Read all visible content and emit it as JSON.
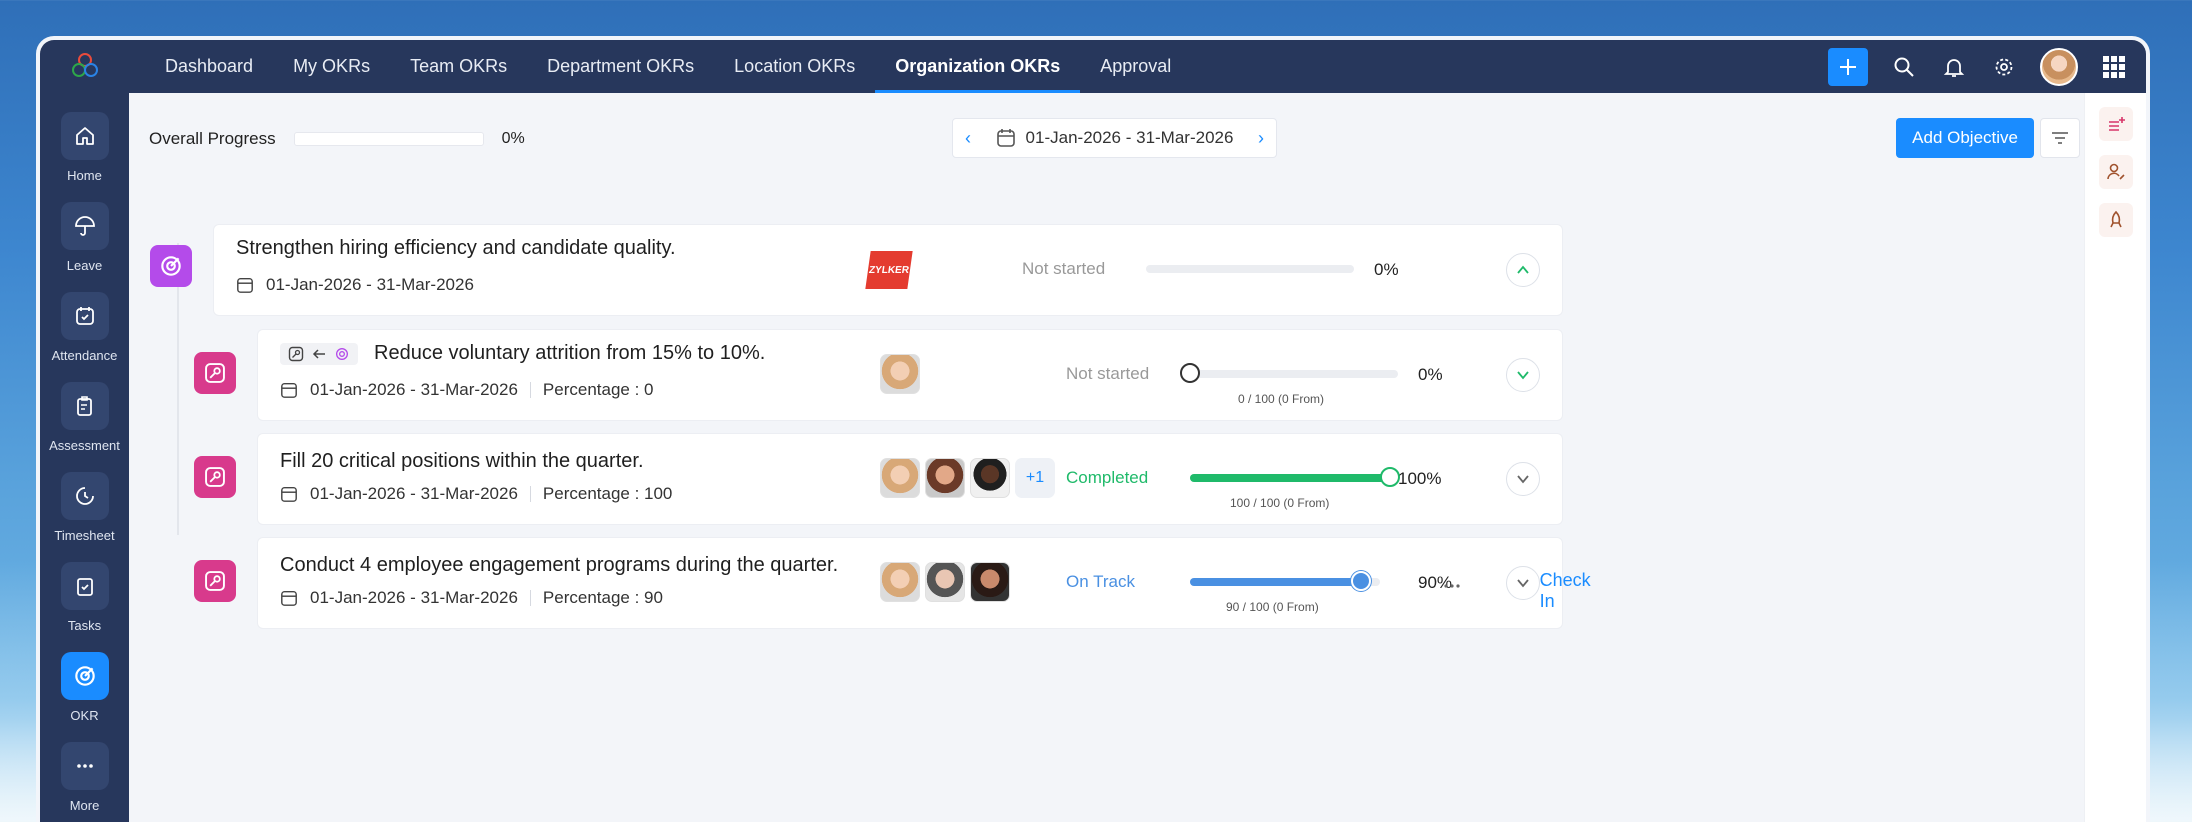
{
  "sidebar": {
    "items": [
      {
        "label": "Home",
        "icon": "home-icon"
      },
      {
        "label": "Leave",
        "icon": "umbrella-icon"
      },
      {
        "label": "Attendance",
        "icon": "calendar-check-icon"
      },
      {
        "label": "Assessment",
        "icon": "clipboard-edit-icon"
      },
      {
        "label": "Timesheet",
        "icon": "clock-refresh-icon"
      },
      {
        "label": "Tasks",
        "icon": "clipboard-check-icon"
      },
      {
        "label": "OKR",
        "icon": "target-icon",
        "active": true
      },
      {
        "label": "More",
        "icon": "more-dots-icon"
      }
    ]
  },
  "topnav": {
    "tabs": [
      "Dashboard",
      "My OKRs",
      "Team OKRs",
      "Department OKRs",
      "Location OKRs",
      "Organization OKRs",
      "Approval"
    ],
    "active_tab": "Organization OKRs"
  },
  "toolbar": {
    "overall_label": "Overall Progress",
    "overall_pct": "0%",
    "overall_progress": 0,
    "date_range": "01-Jan-2026 - 31-Mar-2026",
    "add_objective": "Add Objective"
  },
  "objective": {
    "title": "Strengthen hiring efficiency and candidate quality.",
    "date": "01-Jan-2026 - 31-Mar-2026",
    "owner_logo_text": "ZYLKER",
    "status": "Not started",
    "pct": "0%",
    "progress": 0
  },
  "key_results": [
    {
      "title": "Reduce voluntary attrition from 15% to 10%.",
      "date": "01-Jan-2026 - 31-Mar-2026",
      "percentage": "Percentage : 0",
      "status": "Not started",
      "pct": "0%",
      "progress_text": "0 / 100 (0 From)",
      "progress": 0
    },
    {
      "title": "Fill 20 critical positions within the quarter.",
      "date": "01-Jan-2026 - 31-Mar-2026",
      "percentage": "Percentage : 100",
      "status": "Completed",
      "pct": "100%",
      "progress_text": "100 / 100 (0 From)",
      "progress": 100,
      "more_count": "+1"
    },
    {
      "title": "Conduct 4 employee engagement programs during the quarter.",
      "date": "01-Jan-2026 - 31-Mar-2026",
      "percentage": "Percentage : 90",
      "status": "On Track",
      "pct": "90%",
      "progress_text": "90 / 100 (0 From)",
      "progress": 90,
      "checkin": "Check In"
    }
  ],
  "colors": {
    "accent": "#1a8cff",
    "navy": "#27375c",
    "completed": "#1fba6a",
    "on_track": "#4a90e2",
    "not_started": "#999999"
  }
}
